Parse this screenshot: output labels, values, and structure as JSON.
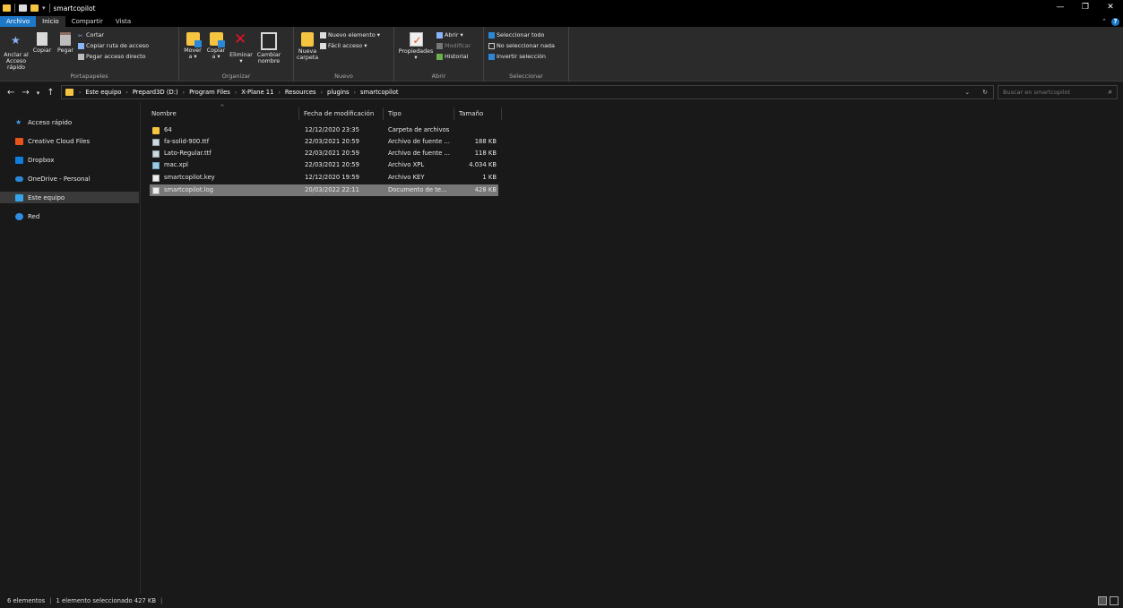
{
  "window": {
    "title": "smartcopilot",
    "controls": [
      "—",
      "❐",
      "✕"
    ]
  },
  "ribbon_tabs": [
    {
      "label": "Archivo"
    },
    {
      "label": "Inicio"
    },
    {
      "label": "Compartir"
    },
    {
      "label": "Vista"
    }
  ],
  "ribbon": {
    "portapapeles": {
      "group_label": "Portapapeles",
      "pin_label": "Anclar al\nAcceso rápido",
      "copy_label": "Copiar",
      "paste_label": "Pegar",
      "cut_label": "Cortar",
      "copy_path_label": "Copiar ruta de acceso",
      "paste_shortcut_label": "Pegar acceso directo"
    },
    "organizar": {
      "group_label": "Organizar",
      "move_label": "Mover\na ▾",
      "copyto_label": "Copiar\na ▾",
      "delete_label": "Eliminar\n▾",
      "rename_label": "Cambiar\nnombre"
    },
    "nuevo": {
      "group_label": "Nuevo",
      "new_folder_label": "Nueva\ncarpeta",
      "new_item_label": "Nuevo elemento ▾",
      "easy_access_label": "Fácil acceso ▾"
    },
    "abrir": {
      "group_label": "Abrir",
      "properties_label": "Propiedades\n▾",
      "open_label": "Abrir ▾",
      "edit_label": "Modificar",
      "history_label": "Historial"
    },
    "seleccionar": {
      "group_label": "Seleccionar",
      "select_all_label": "Seleccionar todo",
      "select_none_label": "No seleccionar nada",
      "invert_label": "Invertir selección"
    }
  },
  "address": {
    "breadcrumbs": [
      "Este equipo",
      "Prepard3D (D:)",
      "Program Files",
      "X-Plane 11",
      "Resources",
      "plugins",
      "smartcopilot"
    ],
    "search_placeholder": "Buscar en smartcopilot"
  },
  "navpane": [
    {
      "label": "Acceso rápido",
      "icon": "star-icon"
    },
    {
      "label": "Creative Cloud Files",
      "icon": "creative-cloud-icon"
    },
    {
      "label": "Dropbox",
      "icon": "dropbox-icon"
    },
    {
      "label": "OneDrive - Personal",
      "icon": "onedrive-icon"
    },
    {
      "label": "Este equipo",
      "icon": "pc-icon",
      "selected": true
    },
    {
      "label": "Red",
      "icon": "network-icon"
    }
  ],
  "columns": {
    "name": "Nombre",
    "date": "Fecha de modificación",
    "type": "Tipo",
    "size": "Tamaño"
  },
  "files": [
    {
      "name": "64",
      "date": "12/12/2020 23:35",
      "type": "Carpeta de archivos",
      "size": "",
      "icon": "folder-icon"
    },
    {
      "name": "fa-solid-900.ttf",
      "date": "22/03/2021 20:59",
      "type": "Archivo de fuente ...",
      "size": "188 KB",
      "icon": "font-file-icon"
    },
    {
      "name": "Lato-Regular.ttf",
      "date": "22/03/2021 20:59",
      "type": "Archivo de fuente ...",
      "size": "118 KB",
      "icon": "font-file-icon"
    },
    {
      "name": "mac.xpl",
      "date": "22/03/2021 20:59",
      "type": "Archivo XPL",
      "size": "4.034 KB",
      "icon": "xpl-file-icon"
    },
    {
      "name": "smartcopilot.key",
      "date": "12/12/2020 19:59",
      "type": "Archivo KEY",
      "size": "1 KB",
      "icon": "file-icon"
    },
    {
      "name": "smartcopilot.log",
      "date": "20/03/2022 22:11",
      "type": "Documento de te...",
      "size": "428 KB",
      "icon": "text-file-icon",
      "selected": true
    }
  ],
  "status": {
    "count": "6 elementos",
    "selection": "1 elemento seleccionado  427 KB"
  }
}
